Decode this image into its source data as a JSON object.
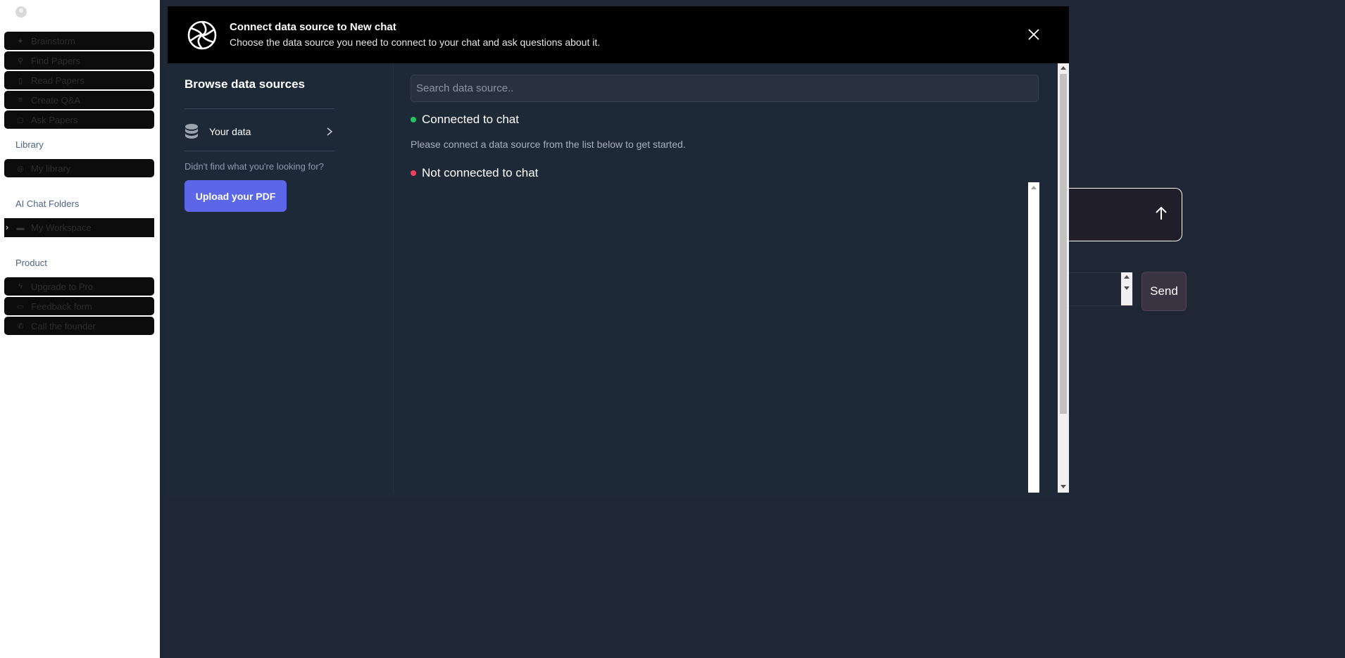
{
  "sidebar": {
    "items": [
      {
        "icon": "sparkle-icon",
        "label": "Brainstorm"
      },
      {
        "icon": "search-icon",
        "label": "Find Papers"
      },
      {
        "icon": "book-icon",
        "label": "Read Papers"
      },
      {
        "icon": "list-icon",
        "label": "Create Q&A"
      },
      {
        "icon": "chat-icon",
        "label": "Ask Papers"
      }
    ],
    "library_label": "Library",
    "library_items": [
      {
        "icon": "database-icon",
        "label": "My library"
      }
    ],
    "folders_label": "AI Chat Folders",
    "folder_items": [
      {
        "icon": "folder-icon",
        "label": "My Workspace"
      }
    ],
    "product_label": "Product",
    "product_items": [
      {
        "icon": "bolt-icon",
        "label": "Upgrade to Pro"
      },
      {
        "icon": "message-icon",
        "label": "Feedback form"
      },
      {
        "icon": "phone-icon",
        "label": "Call the founder"
      }
    ]
  },
  "background": {
    "send_label": "Send"
  },
  "modal": {
    "title": "Connect data source to New chat",
    "subtitle": "Choose the data source you need to connect to your chat and ask questions about it.",
    "browse_title": "Browse data sources",
    "your_data_label": "Your data",
    "not_found_text": "Didn't find what you're looking for?",
    "upload_label": "Upload your PDF",
    "search_placeholder": "Search data source..",
    "connected_label": "Connected to chat",
    "connected_color": "#22c55e",
    "hint_text": "Please connect a data source from the list below to get started.",
    "not_connected_label": "Not connected to chat",
    "not_connected_color": "#f43f5e"
  }
}
